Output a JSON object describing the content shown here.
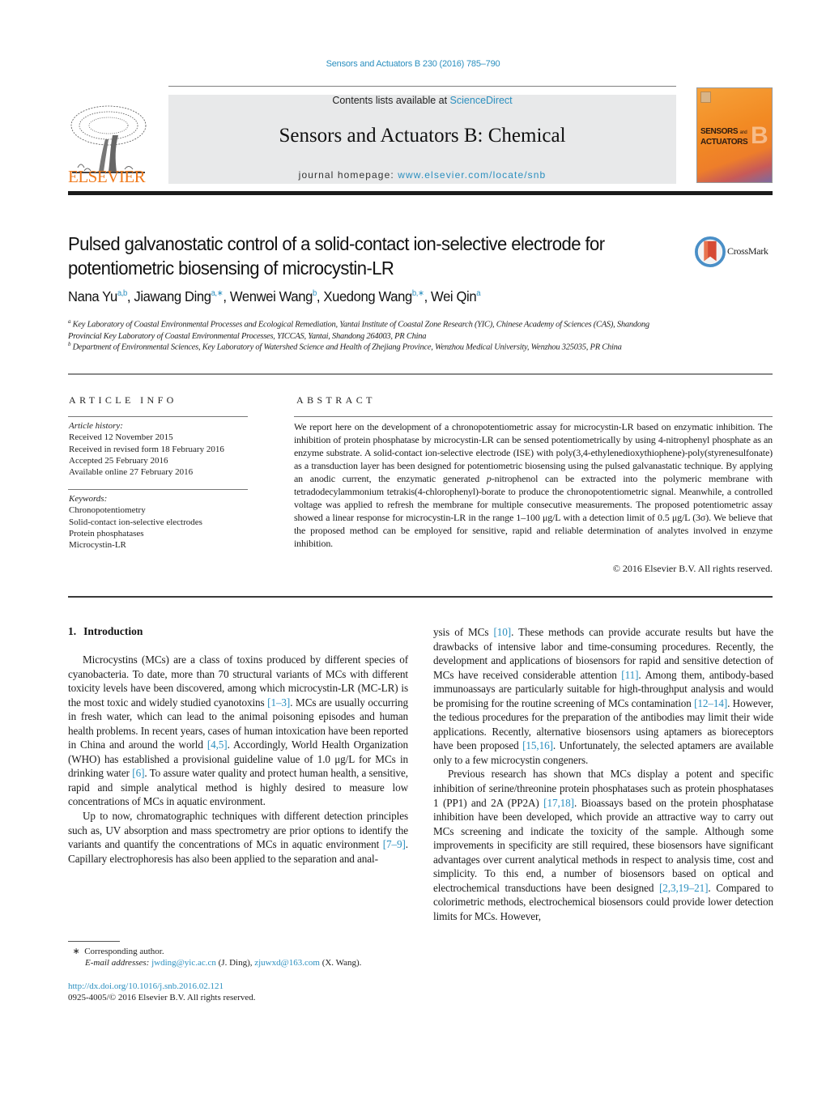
{
  "header": {
    "journal_reference": "Sensors and Actuators B 230 (2016) 785–790",
    "contents_prefix": "Contents lists available at ",
    "contents_link": "ScienceDirect",
    "journal_title": "Sensors and Actuators B: Chemical",
    "homepage_prefix": "journal homepage: ",
    "homepage_link": "www.elsevier.com/locate/snb",
    "publisher_logo_text": "ELSEVIER",
    "cover_line1": "SENSORS",
    "cover_and": "and",
    "cover_line2": "ACTUATORS",
    "cover_letter": "B"
  },
  "article": {
    "title": "Pulsed galvanostatic control of a solid-contact ion-selective electrode for potentiometric biosensing of microcystin-LR",
    "crossmark_label": "CrossMark",
    "authors": [
      {
        "name": "Nana Yu",
        "sup": "a,b"
      },
      {
        "name": "Jiawang Ding",
        "sup": "a,∗"
      },
      {
        "name": "Wenwei Wang",
        "sup": "b"
      },
      {
        "name": "Xuedong Wang",
        "sup": "b,∗"
      },
      {
        "name": "Wei Qin",
        "sup": "a"
      }
    ],
    "affiliations": [
      {
        "mark": "a",
        "text": "Key Laboratory of Coastal Environmental Processes and Ecological Remediation, Yantai Institute of Coastal Zone Research (YIC), Chinese Academy of Sciences (CAS), Shandong Provincial Key Laboratory of Coastal Environmental Processes, YICCAS, Yantai, Shandong 264003, PR China"
      },
      {
        "mark": "b",
        "text": "Department of Environmental Sciences, Key Laboratory of Watershed Science and Health of Zhejiang Province, Wenzhou Medical University, Wenzhou 325035, PR China"
      }
    ]
  },
  "article_info": {
    "heading": "ARTICLE INFO",
    "history_label": "Article history:",
    "history": [
      "Received 12 November 2015",
      "Received in revised form 18 February 2016",
      "Accepted 25 February 2016",
      "Available online 27 February 2016"
    ],
    "keywords_label": "Keywords:",
    "keywords": [
      "Chronopotentiometry",
      "Solid-contact ion-selective electrodes",
      "Protein phosphatases",
      "Microcystin-LR"
    ]
  },
  "abstract": {
    "heading": "ABSTRACT",
    "text_1": "We report here on the development of a chronopotentiometric assay for microcystin-LR based on enzymatic inhibition. The inhibition of protein phosphatase by microcystin-LR can be sensed potentiometrically by using 4-nitrophenyl phosphate as an enzyme substrate. A solid-contact ion-selective electrode (ISE) with poly(3,4-ethylenedioxythiophene)-poly(styrenesulfonate) as a transduction layer has been designed for potentiometric biosensing using the pulsed galvanastatic technique. By applying an anodic current, the enzymatic generated ",
    "text_italic": "p",
    "text_2": "-nitrophenol can be extracted into the polymeric membrane with tetradodecylammonium tetrakis(4-chlorophenyl)-borate to produce the chronopotentiometric signal. Meanwhile, a controlled voltage was applied to refresh the membrane for multiple consecutive measurements. The proposed potentiometric assay showed a linear response for microcystin-LR in the range 1–100 μg/L with a detection limit of 0.5 μg/L (3σ). We believe that the proposed method can be employed for sensitive, rapid and reliable determination of analytes involved in enzyme inhibition.",
    "copyright": "© 2016 Elsevier B.V. All rights reserved."
  },
  "introduction": {
    "number": "1.",
    "heading": "Introduction",
    "p1": [
      {
        "t": "Microcystins (MCs) are a class of toxins produced by different species of cyanobacteria. To date, more than 70 structural variants of MCs with different toxicity levels have been discovered, among which microcystin-LR (MC-LR) is the most toxic and widely studied cyanotoxins "
      },
      {
        "ref": "[1–3]"
      },
      {
        "t": ". MCs are usually occurring in fresh water, which can lead to the animal poisoning episodes and human health problems. In recent years, cases of human intoxication have been reported in China and around the world "
      },
      {
        "ref": "[4,5]"
      },
      {
        "t": ". Accordingly, World Health Organization (WHO) has established a provisional guideline value of 1.0 μg/L for MCs in drinking water "
      },
      {
        "ref": "[6]"
      },
      {
        "t": ". To assure water quality and protect human health, a sensitive, rapid and simple analytical method is highly desired to measure low concentrations of MCs in aquatic environment."
      }
    ],
    "p2": [
      {
        "t": "Up to now, chromatographic techniques with different detection principles such as, UV absorption and mass spectrometry are prior options to identify the variants and quantify the concentrations of MCs in aquatic environment "
      },
      {
        "ref": "[7–9]"
      },
      {
        "t": ". Capillary electrophoresis has also been applied to the separation and analysis of MCs "
      },
      {
        "ref": "[10]"
      },
      {
        "t": ". These methods can provide accurate results but have the drawbacks of intensive labor and time-consuming procedures. Recently, the development and applications of biosensors for rapid and sensitive detection of MCs have received considerable attention "
      },
      {
        "ref": "[11]"
      },
      {
        "t": ". Among them, antibody-based immunoassays are particularly suitable for high-throughput analysis and would be promising for the routine screening of MCs contamination "
      },
      {
        "ref": "[12–14]"
      },
      {
        "t": ". However, the tedious procedures for the preparation of the antibodies may limit their wide applications. Recently, alternative biosensors using aptamers as bioreceptors have been proposed "
      },
      {
        "ref": "[15,16]"
      },
      {
        "t": ". Unfortunately, the selected aptamers are available only to a few microcystin congeners."
      }
    ],
    "p3": [
      {
        "t": "Previous research has shown that MCs display a potent and specific inhibition of serine/threonine protein phosphatases such as protein phosphatases 1 (PP1) and 2A (PP2A) "
      },
      {
        "ref": "[17,18]"
      },
      {
        "t": ". Bioassays based on the protein phosphatase inhibition have been developed, which provide an attractive way to carry out MCs screening and indicate the toxicity of the sample. Although some improvements in specificity are still required, these biosensors have significant advantages over current analytical methods in respect to analysis time, cost and simplicity. To this end, a number of biosensors based on optical and electrochemical transductions have been designed "
      },
      {
        "ref": "[2,3,19–21]"
      },
      {
        "t": ". Compared to colorimetric methods, electrochemical biosensors could provide lower detection limits for MCs. However,"
      }
    ]
  },
  "footnotes": {
    "star": "∗",
    "corresponding": "Corresponding author.",
    "email_label": "E-mail addresses:",
    "email1": "jwding@yic.ac.cn",
    "email1_name": " (J. Ding), ",
    "email2": "zjuwxd@163.com",
    "email2_name": " (X. Wang).",
    "doi": "http://dx.doi.org/10.1016/j.snb.2016.02.121",
    "issn": "0925-4005/© 2016 Elsevier B.V. All rights reserved."
  },
  "colors": {
    "link": "#2b8fbf",
    "elsevier_orange": "#f07a1c",
    "banner_bg": "#e8e9ea"
  }
}
